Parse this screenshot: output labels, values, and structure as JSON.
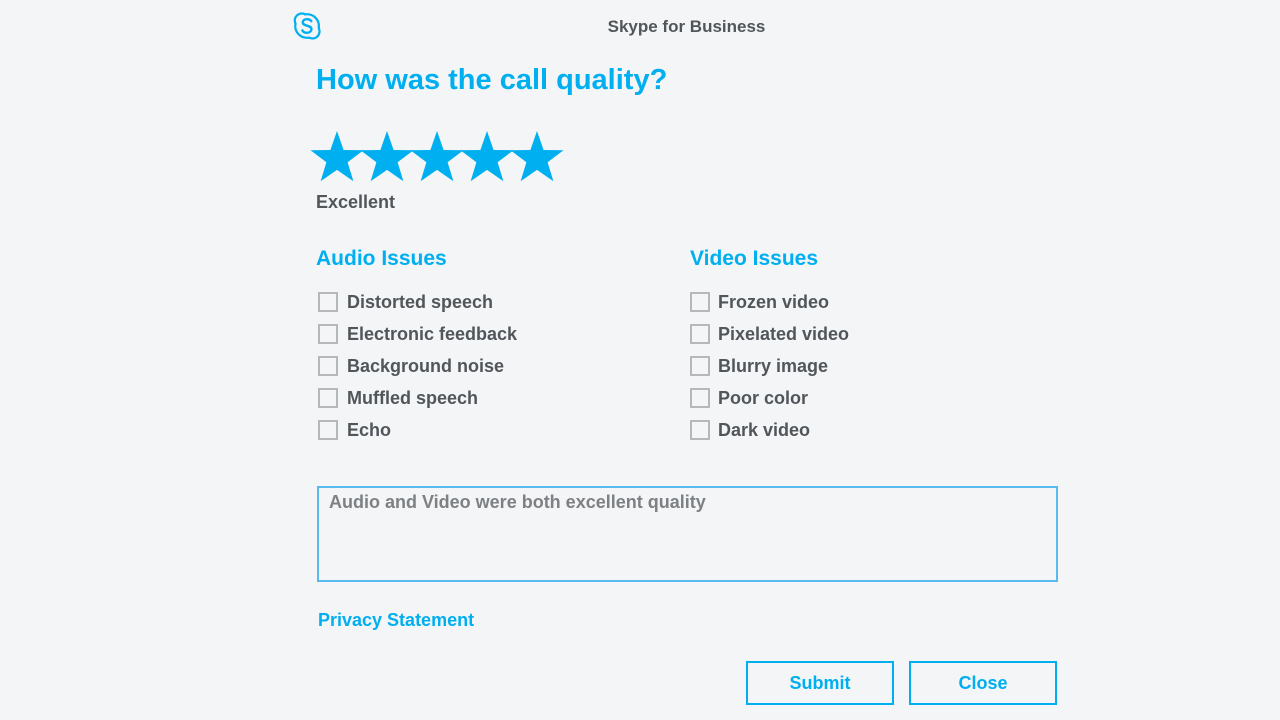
{
  "window": {
    "title": "Skype for Business",
    "logo_icon": "skype-logo-icon"
  },
  "survey": {
    "question": "How was the call quality?",
    "rating": {
      "value": 5,
      "max": 5,
      "label": "Excellent"
    },
    "audio": {
      "heading": "Audio Issues",
      "options": [
        {
          "label": "Distorted speech",
          "checked": false
        },
        {
          "label": "Electronic feedback",
          "checked": false
        },
        {
          "label": "Background noise",
          "checked": false
        },
        {
          "label": "Muffled speech",
          "checked": false
        },
        {
          "label": "Echo",
          "checked": false
        }
      ]
    },
    "video": {
      "heading": "Video Issues",
      "options": [
        {
          "label": "Frozen video",
          "checked": false
        },
        {
          "label": "Pixelated video",
          "checked": false
        },
        {
          "label": "Blurry image",
          "checked": false
        },
        {
          "label": "Poor color",
          "checked": false
        },
        {
          "label": "Dark video",
          "checked": false
        }
      ]
    },
    "comment": {
      "value": "Audio and Video were both excellent quality"
    },
    "privacy_link": "Privacy Statement",
    "buttons": {
      "submit": "Submit",
      "close": "Close"
    }
  },
  "colors": {
    "accent": "#00aff0",
    "text": "#51565a",
    "background": "#f3f5f7",
    "checkbox_border": "#b4b8bb"
  }
}
